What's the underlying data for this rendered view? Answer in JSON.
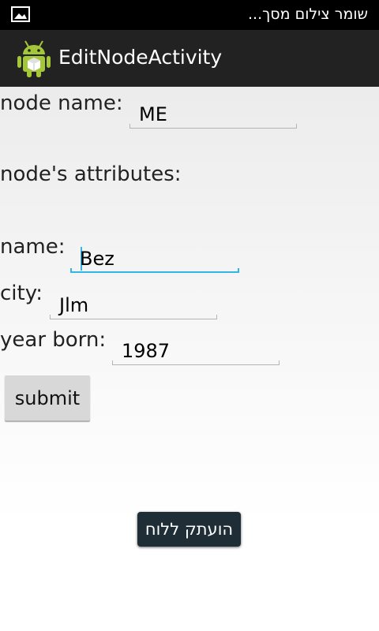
{
  "status_bar": {
    "notification_icon": "gallery-image-icon",
    "text": "שומר צילום מסך..."
  },
  "action_bar": {
    "app_icon": "android-robot-icon",
    "title": "EditNodeActivity"
  },
  "form": {
    "node_name": {
      "label": "node name:",
      "value": "ME"
    },
    "attributes_heading": "node's attributes:",
    "name": {
      "label": "name:",
      "value": "Bez"
    },
    "city": {
      "label": "city:",
      "value": "Jlm"
    },
    "year_born": {
      "label": "year born:",
      "value": "1987"
    },
    "submit_label": "submit"
  },
  "toast": {
    "text": "הועתק ללוח"
  },
  "colors": {
    "focus_accent": "#33b5e5",
    "action_bar": "#222222",
    "toast_background": "#1f2d37"
  }
}
